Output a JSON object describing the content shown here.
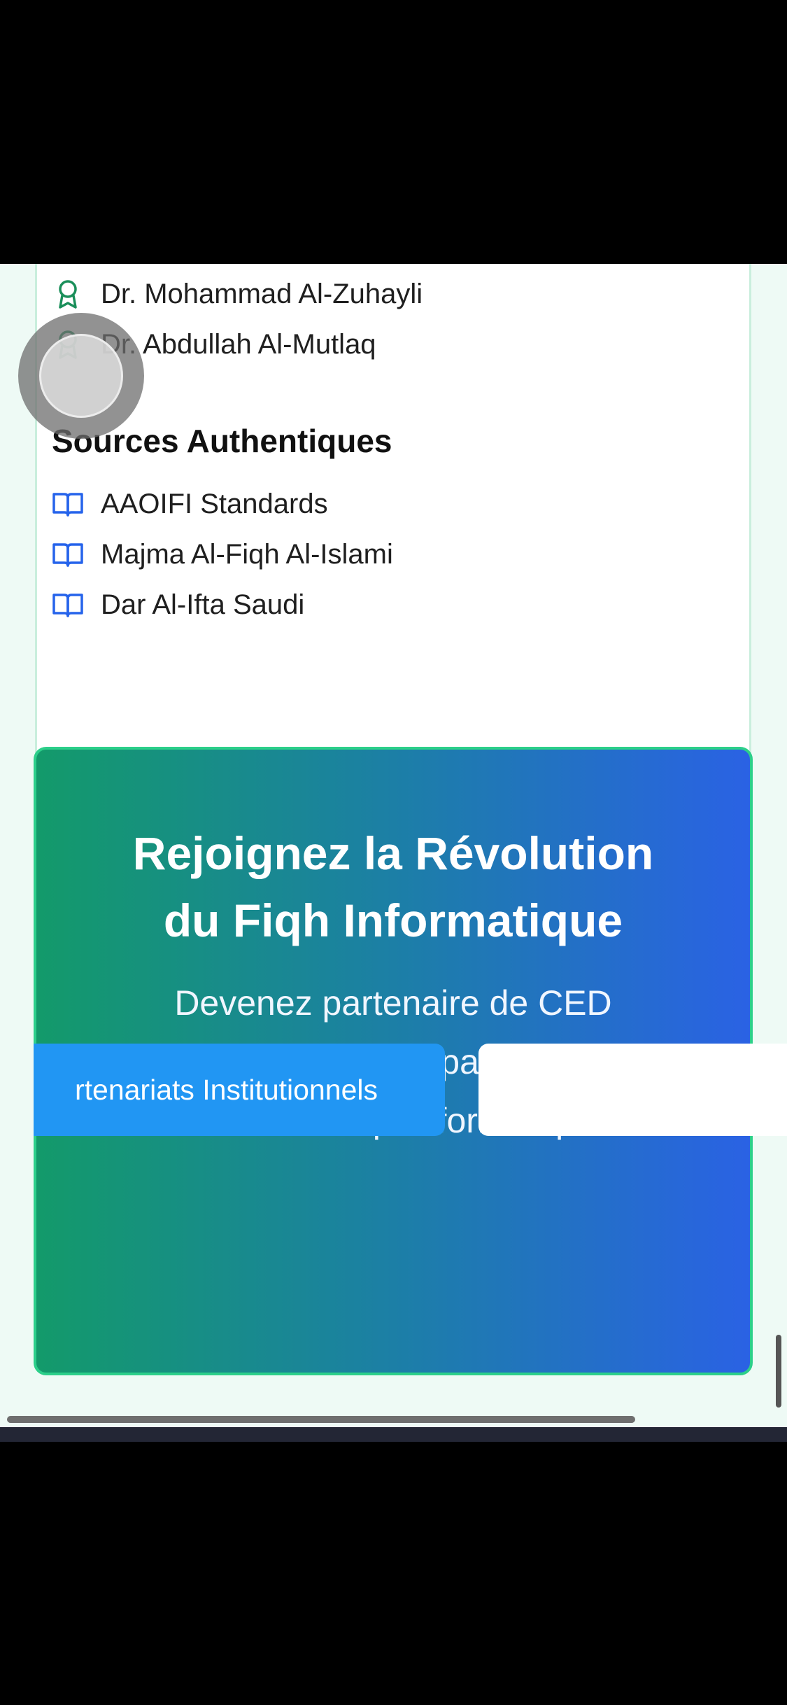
{
  "scholars": [
    {
      "name": "Dr. Mohammad Al-Zuhayli"
    },
    {
      "name": "Dr. Abdullah Al-Mutlaq"
    }
  ],
  "sources": {
    "title": "Sources Authentiques",
    "items": [
      {
        "name": "AAOIFI Standards"
      },
      {
        "name": "Majma Al-Fiqh Al-Islami"
      },
      {
        "name": "Dar Al-Ifta Saudi"
      }
    ]
  },
  "cta": {
    "title_line1": "Rejoignez la Révolution",
    "title_line2": "du Fiqh Informatique",
    "subtitle_line1": "Devenez partenaire de CED",
    "subtitle_line2": "Academy dans l'expansion vers",
    "subtitle_line3": "100% du Fiqh informatique",
    "primary_button": "rtenariats Institutionnels",
    "secondary_button": ""
  },
  "icons": {
    "scholar": "award-icon",
    "source": "book-open-icon"
  },
  "colors": {
    "scholar_icon": "#1a8f5a",
    "source_icon": "#2563eb",
    "cta_gradient_start": "#139a6a",
    "cta_gradient_end": "#2a62e4",
    "primary_button": "#2196f3"
  }
}
